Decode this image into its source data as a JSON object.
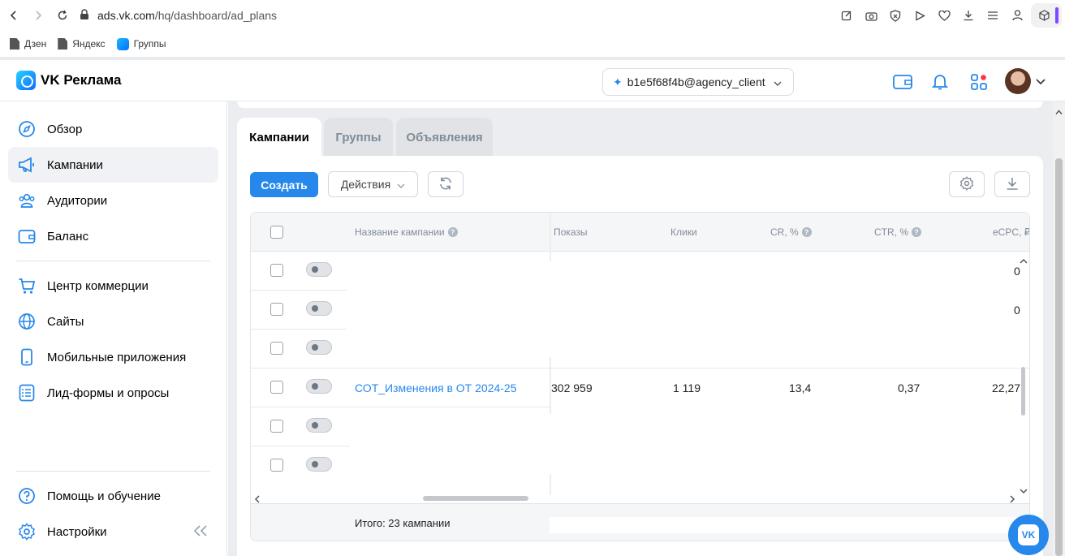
{
  "browser": {
    "url_host": "ads.vk.com",
    "url_path": "/hq/dashboard/ad_plans",
    "bookmarks": [
      "Дзен",
      "Яндекс",
      "Группы"
    ]
  },
  "header": {
    "logo_text": "VK Реклама",
    "account": "b1e5f68f4b@agency_client"
  },
  "sidebar": {
    "items": [
      {
        "label": "Обзор",
        "icon": "compass-icon"
      },
      {
        "label": "Кампании",
        "icon": "megaphone-icon"
      },
      {
        "label": "Аудитории",
        "icon": "users-icon"
      },
      {
        "label": "Баланс",
        "icon": "wallet-icon"
      },
      {
        "label": "Центр коммерции",
        "icon": "cart-icon"
      },
      {
        "label": "Сайты",
        "icon": "globe-icon"
      },
      {
        "label": "Мобильные приложения",
        "icon": "phone-icon"
      },
      {
        "label": "Лид-формы и опросы",
        "icon": "list-icon"
      }
    ],
    "bottom": [
      {
        "label": "Помощь и обучение",
        "icon": "help-icon"
      },
      {
        "label": "Настройки",
        "icon": "gear-icon"
      }
    ]
  },
  "tabs": [
    "Кампании",
    "Группы",
    "Объявления"
  ],
  "toolbar": {
    "create_label": "Создать",
    "actions_label": "Действия"
  },
  "table": {
    "headers": {
      "name": "Название кампании",
      "impressions": "Показы",
      "clicks": "Клики",
      "cr": "CR, %",
      "ctr": "CTR, %",
      "ecpc": "eCPC, ₽"
    },
    "row_partial_values": [
      "0",
      "0"
    ],
    "campaign": {
      "name": "СОТ_Изменения в ОТ 2024-25",
      "impressions": "302 959",
      "clicks": "1 119",
      "cr": "13,4",
      "ctr": "0,37",
      "ecpc": "22,27"
    },
    "footer": "Итого: 23 кампании"
  }
}
